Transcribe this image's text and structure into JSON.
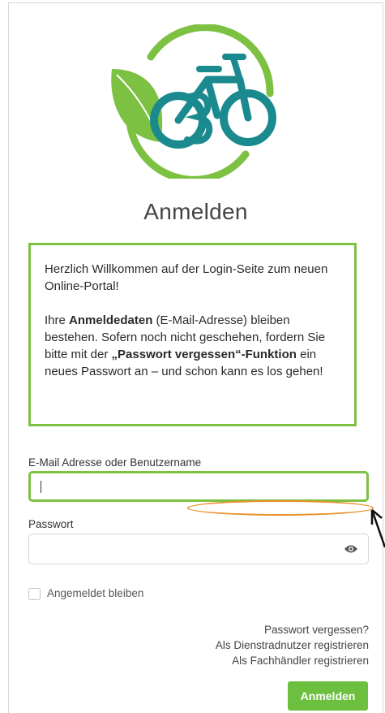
{
  "page": {
    "title": "Anmelden"
  },
  "info": {
    "p1": "Herzlich Willkommen auf der Login-Seite zum neuen Online-Portal!",
    "p2_a": "Ihre ",
    "p2_b": "Anmeldedaten",
    "p2_c": " (E-Mail-Adresse) bleiben bestehen. Sofern noch nicht geschehen, fordern Sie bitte mit der ",
    "p2_d": "„Passwort vergessen“-Funktion",
    "p2_e": " ein neues Passwort an – und schon kann es los gehen!"
  },
  "form": {
    "email_label": "E-Mail Adresse oder Benutzername",
    "email_value": "",
    "password_label": "Passwort",
    "password_value": "",
    "remember_label": "Angemeldet bleiben",
    "submit_label": "Anmelden"
  },
  "links": {
    "forgot": "Passwort vergessen?",
    "register_bike": "Als Dienstradnutzer registrieren",
    "register_dealer": "Als Fachhändler registrieren"
  },
  "icons": {
    "logo": "ebike-leaf-logo",
    "toggle_visibility": "eye-icon"
  },
  "colors": {
    "accent": "#7cc142",
    "button": "#6dbf3f",
    "logo_bike": "#1a8a8f",
    "annotation": "#e8902a"
  }
}
